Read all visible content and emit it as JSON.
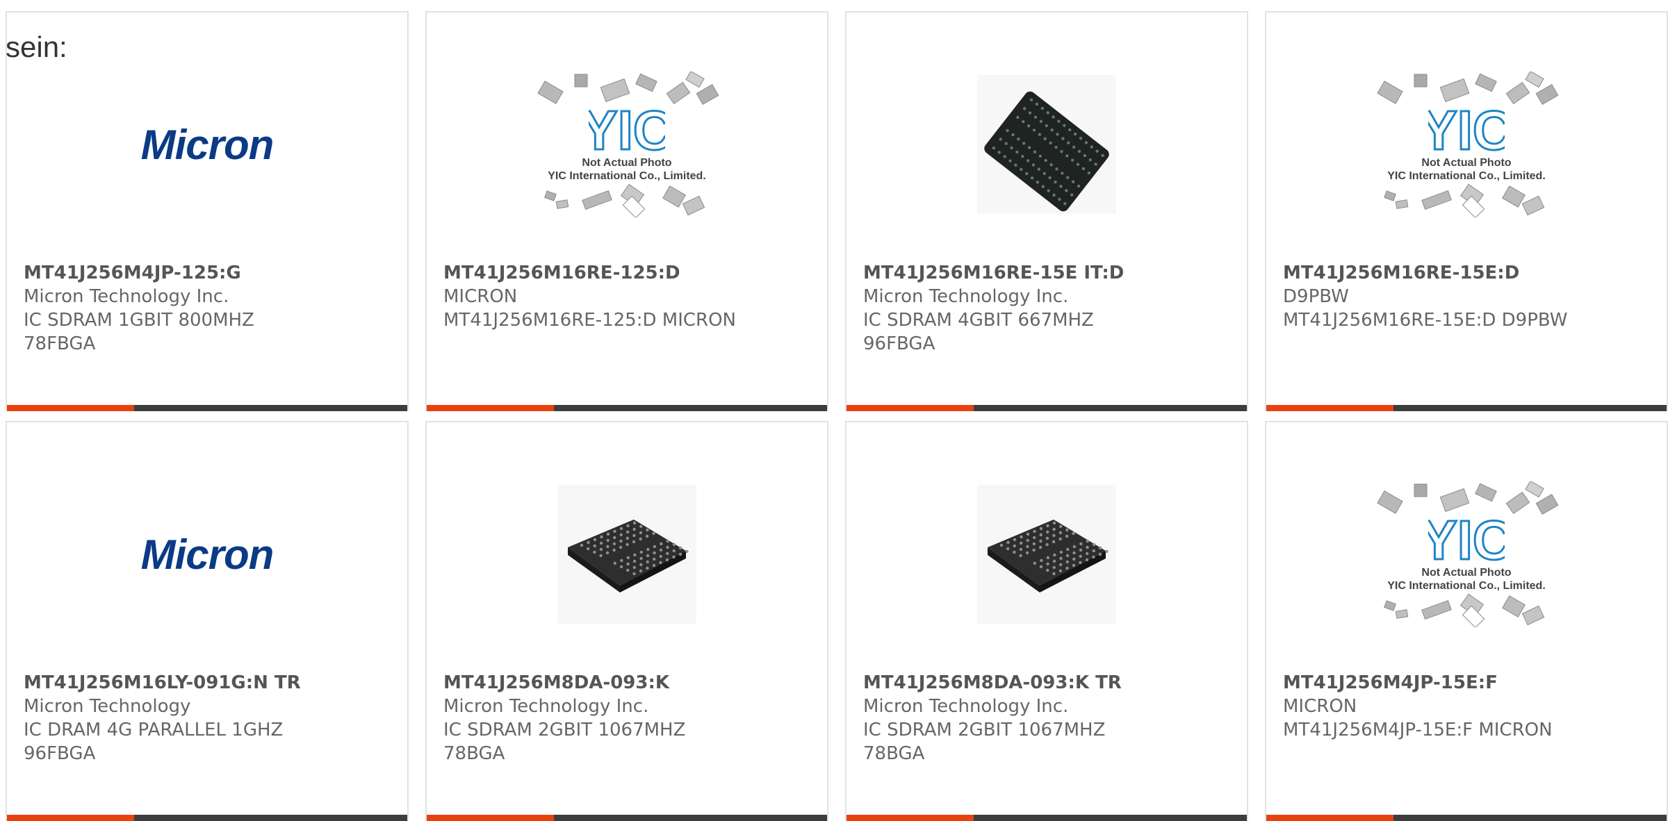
{
  "intro_text": "sein:",
  "colors": {
    "accent": "#e8430f",
    "bar": "#3d3d3d",
    "micron_blue": "#0b3a86",
    "yic_blue": "#1c84c6"
  },
  "placeholder": {
    "caption_line1": "Not Actual Photo",
    "caption_line2": "YIC International Co., Limited.",
    "logo_text": "YIC"
  },
  "micron_logo_text": "Micron",
  "products": [
    {
      "part": "MT41J256M4JP-125:G",
      "lines": [
        "Micron Technology Inc.",
        "IC SDRAM 1GBIT 800MHZ",
        "78FBGA"
      ],
      "image": "micron-logo"
    },
    {
      "part": "MT41J256M16RE-125:D",
      "lines": [
        "MICRON",
        "MT41J256M16RE-125:D MICRON"
      ],
      "image": "yic-placeholder"
    },
    {
      "part": "MT41J256M16RE-15E IT:D",
      "lines": [
        "Micron Technology Inc.",
        "IC SDRAM 4GBIT 667MHZ",
        "96FBGA"
      ],
      "image": "bga-chip-flat"
    },
    {
      "part": "MT41J256M16RE-15E:D",
      "lines": [
        "D9PBW",
        "MT41J256M16RE-15E:D D9PBW"
      ],
      "image": "yic-placeholder"
    },
    {
      "part": "MT41J256M16LY-091G:N TR",
      "lines": [
        "Micron Technology",
        "IC DRAM 4G PARALLEL 1GHZ",
        "96FBGA"
      ],
      "image": "micron-logo"
    },
    {
      "part": "MT41J256M8DA-093:K",
      "lines": [
        "Micron Technology Inc.",
        "IC SDRAM 2GBIT 1067MHZ",
        "78BGA"
      ],
      "image": "bga-chip-3d"
    },
    {
      "part": "MT41J256M8DA-093:K TR",
      "lines": [
        "Micron Technology Inc.",
        "IC SDRAM 2GBIT 1067MHZ",
        "78BGA"
      ],
      "image": "bga-chip-3d"
    },
    {
      "part": "MT41J256M4JP-15E:F",
      "lines": [
        "MICRON",
        "MT41J256M4JP-15E:F MICRON"
      ],
      "image": "yic-placeholder"
    }
  ]
}
